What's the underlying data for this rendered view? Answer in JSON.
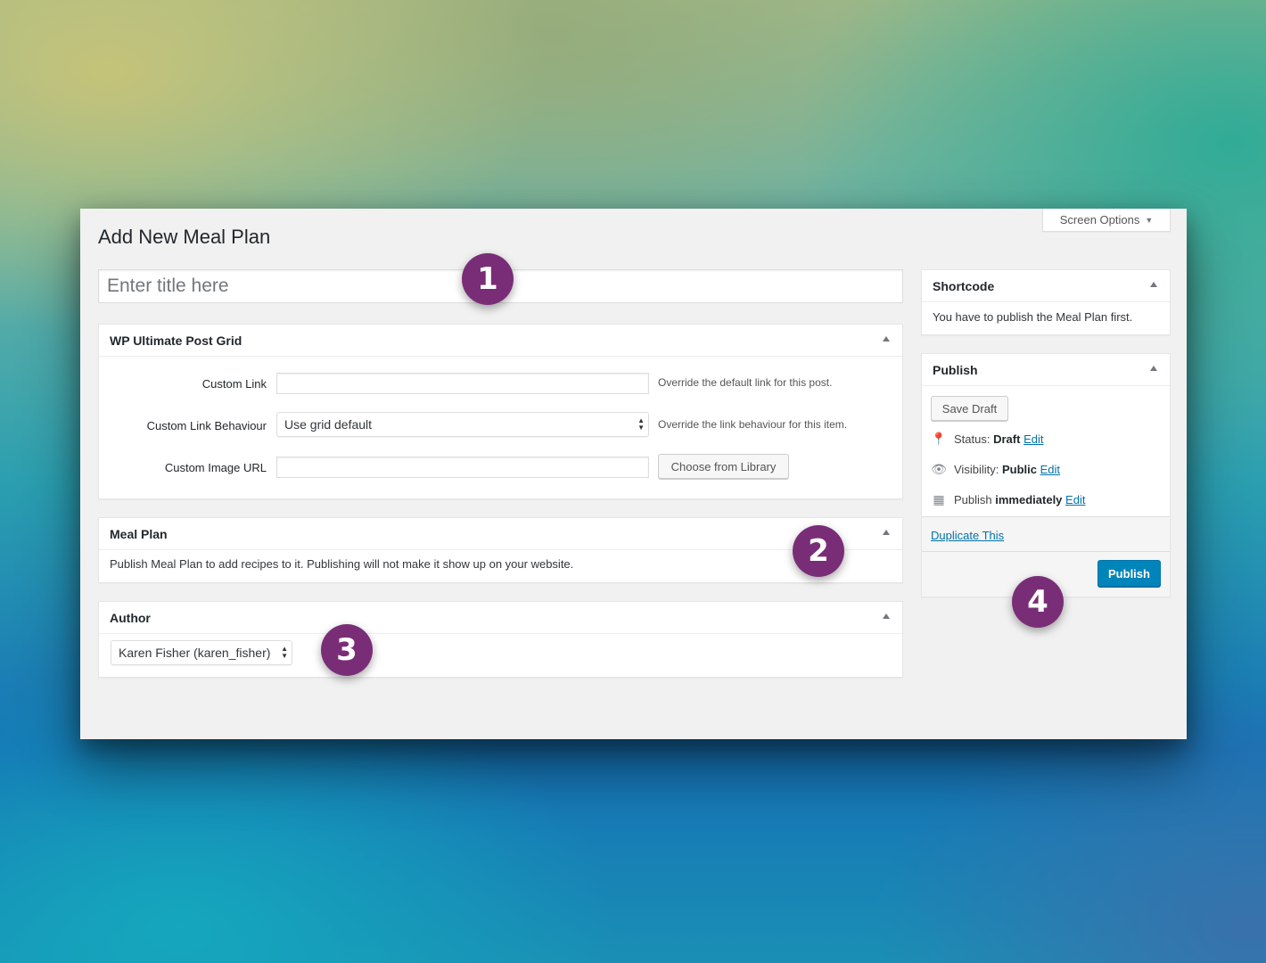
{
  "header": {
    "screen_options_label": "Screen Options",
    "page_title": "Add New Meal Plan",
    "title_placeholder": "Enter title here"
  },
  "post_grid_box": {
    "title": "WP Ultimate Post Grid",
    "custom_link_label": "Custom Link",
    "custom_link_value": "",
    "custom_link_desc": "Override the default link for this post.",
    "behaviour_label": "Custom Link Behaviour",
    "behaviour_value": "Use grid default",
    "behaviour_desc": "Override the link behaviour for this item.",
    "image_url_label": "Custom Image URL",
    "image_url_value": "",
    "choose_button": "Choose from Library"
  },
  "meal_plan_box": {
    "title": "Meal Plan",
    "text": "Publish Meal Plan to add recipes to it. Publishing will not make it show up on your website."
  },
  "author_box": {
    "title": "Author",
    "selected": "Karen Fisher (karen_fisher)"
  },
  "shortcode_box": {
    "title": "Shortcode",
    "text": "You have to publish the Meal Plan first."
  },
  "publish_box": {
    "title": "Publish",
    "save_draft": "Save Draft",
    "status_label": "Status:",
    "status_value": "Draft",
    "visibility_label": "Visibility:",
    "visibility_value": "Public",
    "publish_label": "Publish",
    "publish_value": "immediately",
    "edit_label": "Edit",
    "duplicate_link": "Duplicate This",
    "publish_button": "Publish"
  },
  "callouts": [
    "1",
    "2",
    "3",
    "4"
  ],
  "colors": {
    "callout": "#7a2d77",
    "primary_button": "#0085ba",
    "link": "#0073aa"
  }
}
